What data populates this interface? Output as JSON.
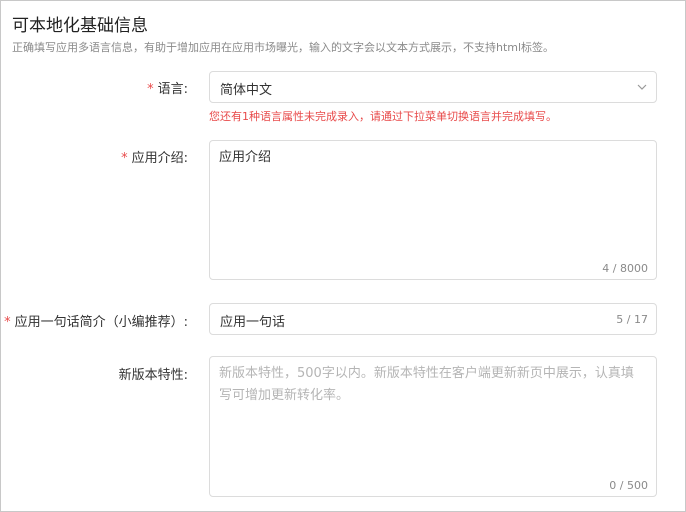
{
  "section": {
    "title": "可本地化基础信息",
    "subtitle": "正确填写应用多语言信息，有助于增加应用在应用市场曝光，输入的文字会以文本方式展示，不支持html标签。"
  },
  "form": {
    "required_mark": "*",
    "language": {
      "label": "语言:",
      "selected": "简体中文",
      "error": "您还有1种语言属性未完成录入，请通过下拉菜单切换语言并完成填写。"
    },
    "intro": {
      "label": "应用介绍:",
      "value": "应用介绍",
      "counter": "4 / 8000"
    },
    "tagline": {
      "label": "应用一句话简介（小编推荐）:",
      "value": "应用一句话",
      "counter": "5 / 17"
    },
    "features": {
      "label": "新版本特性:",
      "placeholder": "新版本特性，500字以内。新版本特性在客户端更新新页中展示，认真填写可增加更新转化率。",
      "counter": "0 / 500"
    }
  },
  "colors": {
    "error": "#e84a4a",
    "border": "#dcdcdc"
  }
}
